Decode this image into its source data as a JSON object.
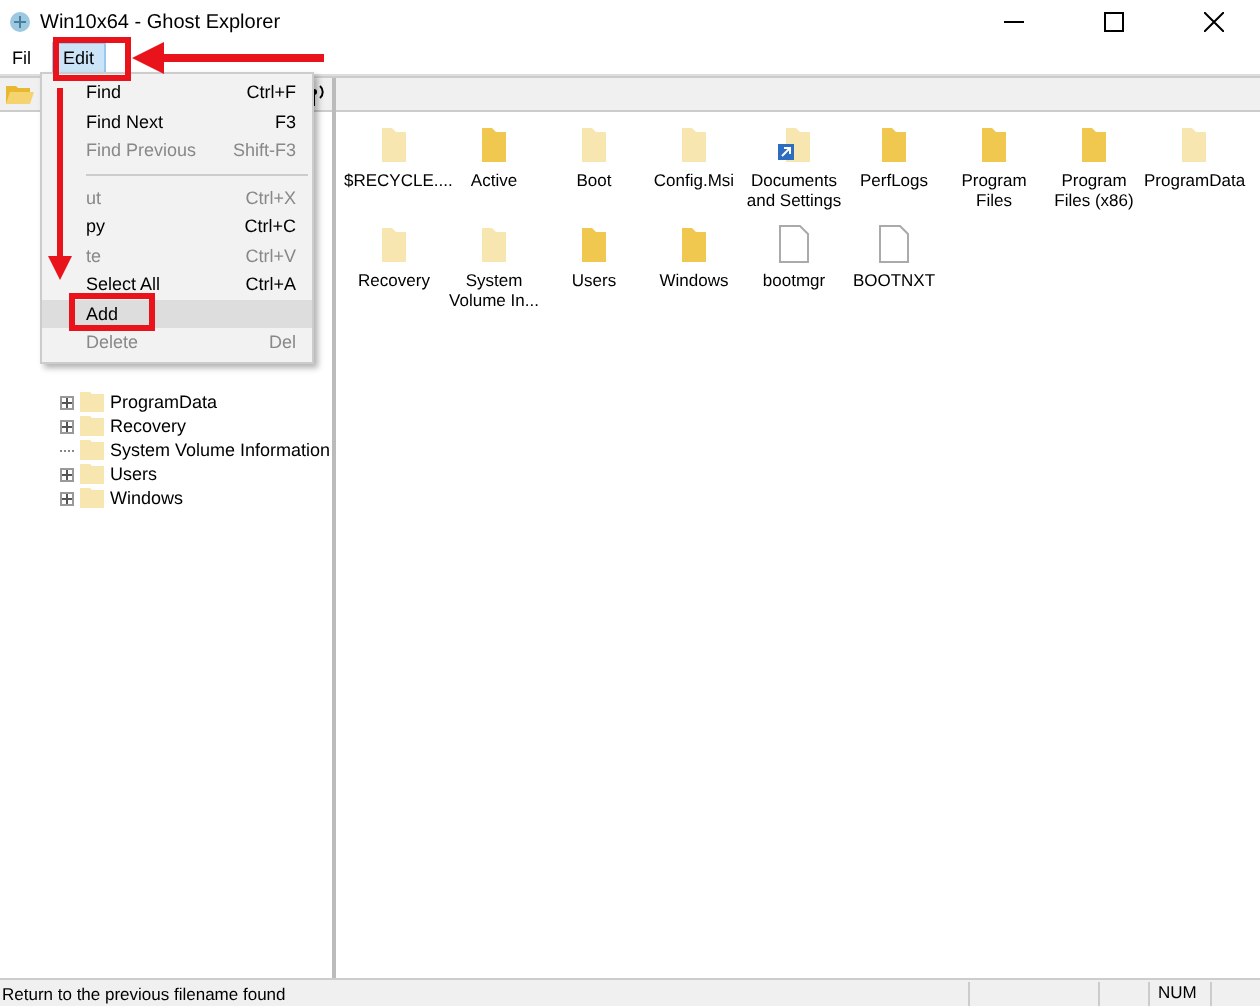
{
  "window": {
    "title": "Win10x64 - Ghost Explorer"
  },
  "menubar": [
    {
      "label": "Fil",
      "selected": false
    },
    {
      "label": "Edit",
      "selected": true
    }
  ],
  "edit_menu": [
    {
      "kind": "item",
      "label": "Find",
      "shortcut": "Ctrl+F",
      "disabled": false,
      "selected": false
    },
    {
      "kind": "item",
      "label": "Find Next",
      "shortcut": "F3",
      "disabled": false,
      "selected": false
    },
    {
      "kind": "item",
      "label": "Find Previous",
      "shortcut": "Shift-F3",
      "disabled": true,
      "selected": false
    },
    {
      "kind": "separator"
    },
    {
      "kind": "item",
      "label": "ut",
      "shortcut": "Ctrl+X",
      "disabled": true,
      "selected": false
    },
    {
      "kind": "item",
      "label": "py",
      "shortcut": "Ctrl+C",
      "disabled": false,
      "selected": false
    },
    {
      "kind": "item",
      "label": "te",
      "shortcut": "Ctrl+V",
      "disabled": true,
      "selected": false
    },
    {
      "kind": "item",
      "label": "Select All",
      "shortcut": "Ctrl+A",
      "disabled": false,
      "selected": false
    },
    {
      "kind": "item",
      "label": "Add",
      "disabled": false,
      "selected": true
    },
    {
      "kind": "item",
      "label": "Delete",
      "shortcut": "Del",
      "disabled": true,
      "selected": false
    }
  ],
  "tree": [
    {
      "label": "ProgramData",
      "has_children": true
    },
    {
      "label": "Recovery",
      "has_children": true
    },
    {
      "label": "System Volume Information",
      "has_children": false
    },
    {
      "label": "Users",
      "has_children": true
    },
    {
      "label": "Windows",
      "has_children": true
    }
  ],
  "files": [
    {
      "kind": "folder",
      "name": "$RECYCLE....",
      "faded": true
    },
    {
      "kind": "folder",
      "name": "Active",
      "faded": false
    },
    {
      "kind": "folder",
      "name": "Boot",
      "faded": true
    },
    {
      "kind": "folder",
      "name": "Config.Msi",
      "faded": true
    },
    {
      "kind": "shortcut",
      "name": "Documents and Settings",
      "faded": true
    },
    {
      "kind": "folder",
      "name": "PerfLogs",
      "faded": false
    },
    {
      "kind": "folder",
      "name": "Program Files",
      "faded": false
    },
    {
      "kind": "folder",
      "name": "Program Files (x86)",
      "faded": false
    },
    {
      "kind": "folder",
      "name": "ProgramData",
      "faded": true
    },
    {
      "kind": "folder",
      "name": "Recovery",
      "faded": true
    },
    {
      "kind": "folder",
      "name": "System Volume In...",
      "faded": true
    },
    {
      "kind": "folder",
      "name": "Users",
      "faded": false
    },
    {
      "kind": "folder",
      "name": "Windows",
      "faded": false
    },
    {
      "kind": "file",
      "name": "bootmgr"
    },
    {
      "kind": "file",
      "name": "BOOTNXT"
    }
  ],
  "status_bar": {
    "message": "Return to the previous filename found",
    "num": "NUM"
  }
}
